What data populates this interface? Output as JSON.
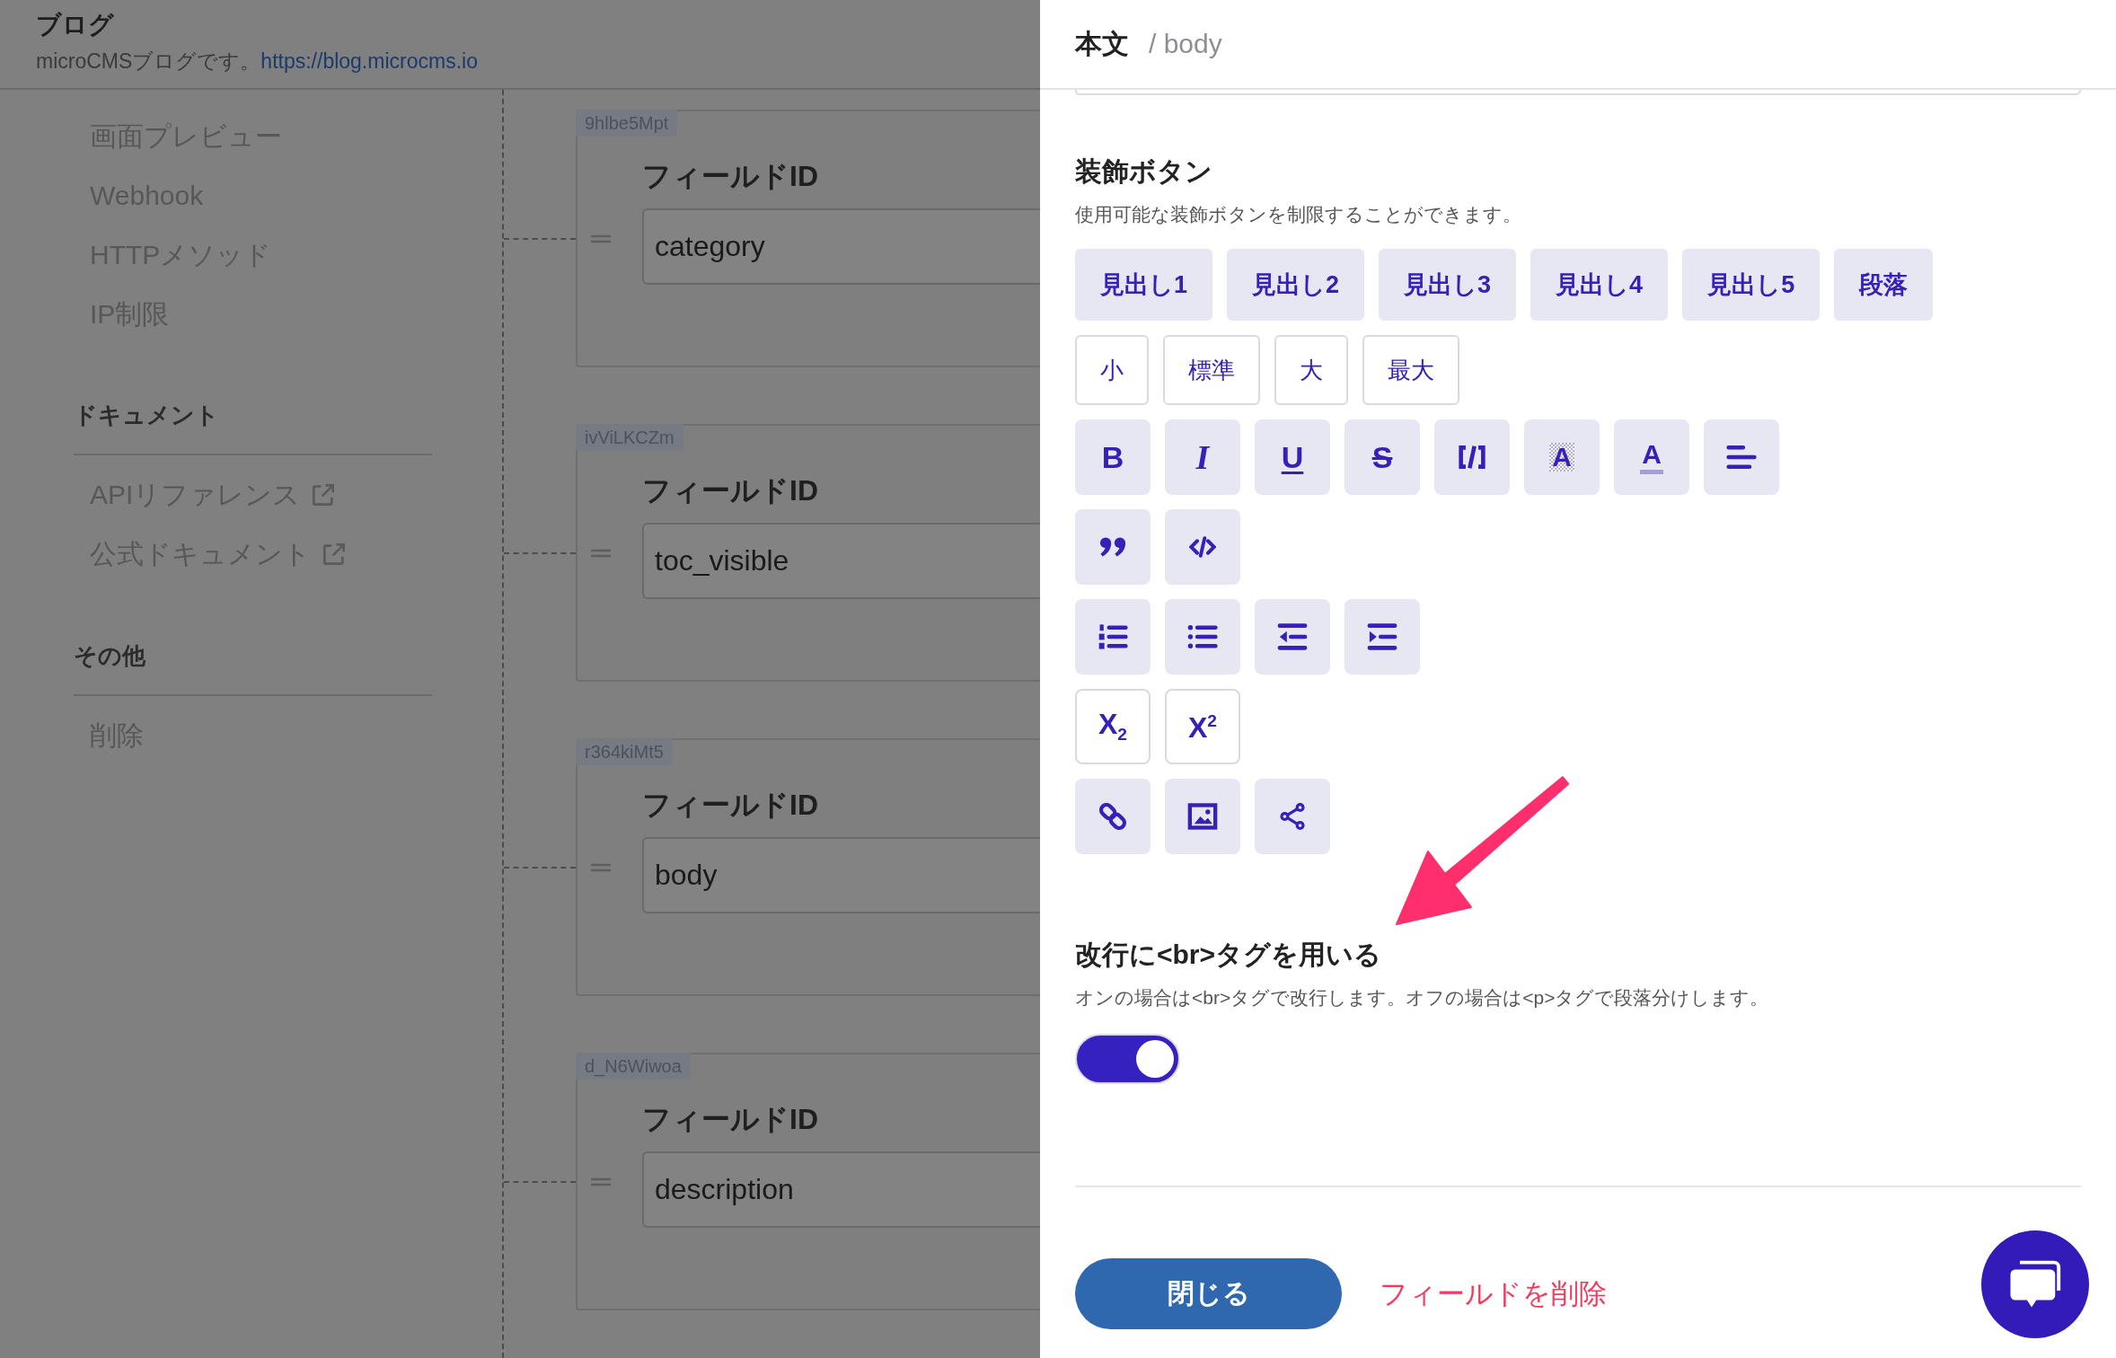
{
  "background_page": {
    "header": {
      "title": "ブログ",
      "description": "microCMSブログです。",
      "link": "https://blog.microcms.io"
    },
    "sidebar": {
      "items": [
        "画面プレビュー",
        "Webhook",
        "HTTPメソッド",
        "IP制限"
      ],
      "sections": [
        {
          "title": "ドキュメント",
          "items": [
            {
              "label": "APIリファレンス",
              "external": true
            },
            {
              "label": "公式ドキュメント",
              "external": true
            }
          ]
        },
        {
          "title": "その他",
          "items": [
            {
              "label": "削除",
              "external": false
            }
          ]
        }
      ]
    },
    "fields": [
      {
        "tag": "9hlbe5Mpt",
        "label": "フィールドID",
        "value": "category"
      },
      {
        "tag": "ivViLKCZm",
        "label": "フィールドID",
        "value": "toc_visible"
      },
      {
        "tag": "r364kiMt5",
        "label": "フィールドID",
        "value": "body"
      },
      {
        "tag": "d_N6Wiwoa",
        "label": "フィールドID",
        "value": "description"
      }
    ]
  },
  "panel": {
    "title": "本文",
    "subtitle": "/ body",
    "decoration": {
      "title": "装飾ボタン",
      "description": "使用可能な装飾ボタンを制限することができます。",
      "button_rows": [
        {
          "kind": "heading",
          "buttons": [
            {
              "label": "見出し1",
              "selected": true
            },
            {
              "label": "見出し2",
              "selected": true
            },
            {
              "label": "見出し3",
              "selected": true
            },
            {
              "label": "見出し4",
              "selected": true
            },
            {
              "label": "見出し5",
              "selected": true
            },
            {
              "label": "段落",
              "selected": true
            }
          ]
        },
        {
          "kind": "size",
          "buttons": [
            {
              "label": "小",
              "selected": false
            },
            {
              "label": "標準",
              "selected": false
            },
            {
              "label": "大",
              "selected": false
            },
            {
              "label": "最大",
              "selected": false
            }
          ]
        },
        {
          "kind": "icon",
          "buttons": [
            {
              "kind": "bold",
              "label": "B",
              "selected": true
            },
            {
              "kind": "italic",
              "label": "I",
              "selected": true
            },
            {
              "kind": "underline",
              "label": "U",
              "selected": true
            },
            {
              "kind": "strike",
              "label": "S",
              "selected": true
            },
            {
              "kind": "inline_code",
              "selected": true
            },
            {
              "kind": "background_color",
              "label": "A",
              "selected": true
            },
            {
              "kind": "text_color",
              "label": "A",
              "selected": true
            },
            {
              "kind": "align",
              "selected": true
            }
          ]
        },
        {
          "kind": "icon",
          "buttons": [
            {
              "kind": "quote",
              "selected": true
            },
            {
              "kind": "code_block",
              "selected": true
            }
          ]
        },
        {
          "kind": "icon",
          "buttons": [
            {
              "kind": "ordered_list",
              "selected": true
            },
            {
              "kind": "bullet_list",
              "selected": true
            },
            {
              "kind": "outdent",
              "selected": true
            },
            {
              "kind": "indent",
              "selected": true
            }
          ]
        },
        {
          "kind": "icon",
          "buttons": [
            {
              "kind": "subscript",
              "label": "X$_{2}$",
              "selected": false
            },
            {
              "kind": "superscript",
              "label": "X$^{2}$",
              "selected": false
            }
          ]
        },
        {
          "kind": "icon",
          "buttons": [
            {
              "kind": "link",
              "selected": true
            },
            {
              "kind": "image",
              "selected": true
            },
            {
              "kind": "embed",
              "selected": true
            }
          ]
        }
      ]
    },
    "line_break": {
      "title": "改行に<br>タグを用いる",
      "description": "オンの場合は<br>タグで改行します。オフの場合は<p>タグで段落分けします。",
      "on": true
    },
    "close_button": "閉じる",
    "delete_link": "フィールドを削除"
  }
}
